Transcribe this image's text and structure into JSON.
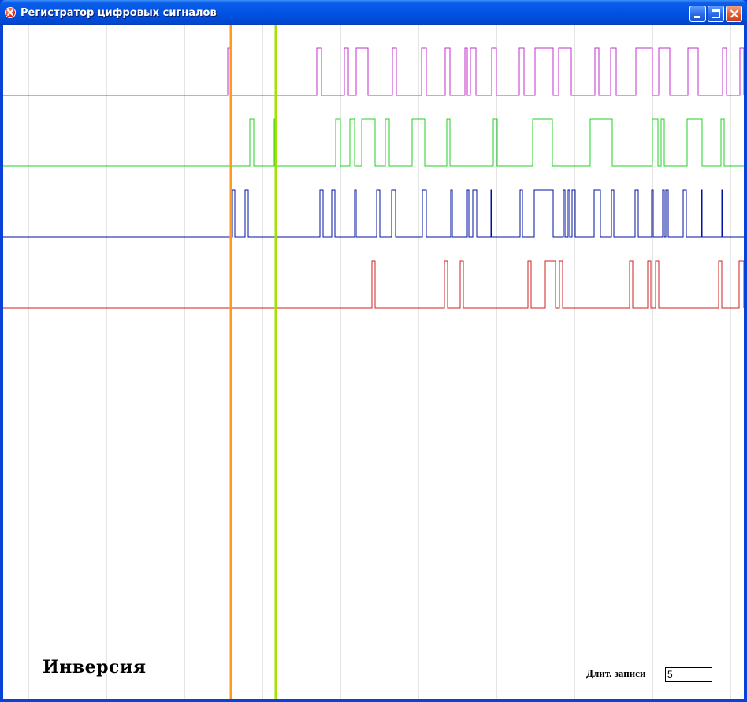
{
  "window": {
    "title": "Регистратор цифровых сигналов"
  },
  "controls": {
    "inversion_label": "Инверсия",
    "duration_label": "Длит. записи",
    "duration_value": "5"
  },
  "colors": {
    "grid": "#c8c8c8",
    "cursor_left": "#ff9a1f",
    "cursor_right": "#a4e000",
    "channels": [
      "#c030c8",
      "#20d020",
      "#0010a0",
      "#d02020"
    ]
  },
  "chart_data": {
    "type": "line",
    "title": "",
    "xlabel": "",
    "ylabel": "",
    "grid": "vertical",
    "cursors": [
      {
        "name": "cursor-left",
        "x": 289
      },
      {
        "name": "cursor-right",
        "x": 346
      }
    ],
    "series": [
      {
        "transitions": [
          285,
          289,
          398,
          404,
          433,
          438,
          448,
          463,
          494,
          499,
          531,
          537,
          561,
          567,
          586,
          589,
          593,
          600,
          620,
          626,
          655,
          661,
          675,
          698,
          705,
          721,
          751,
          756,
          771,
          778,
          803,
          824,
          832,
          846,
          869,
          882,
          913,
          918,
          935,
          940
        ]
      },
      {
        "transitions": [
          313,
          318,
          344,
          346,
          422,
          428,
          440,
          446,
          455,
          472,
          485,
          490,
          519,
          535,
          563,
          567,
          622,
          627,
          672,
          697,
          745,
          773,
          824,
          831,
          835,
          839,
          868,
          887,
          911,
          915
        ]
      },
      {
        "transitions": [
          291,
          294,
          307,
          311,
          345,
          346,
          402,
          406,
          417,
          421,
          446,
          448,
          474,
          478,
          493,
          498,
          532,
          537,
          568,
          570,
          589,
          591,
          596,
          601,
          619,
          620,
          656,
          659,
          674,
          698,
          711,
          713,
          717,
          719,
          722,
          726,
          750,
          758,
          772,
          775,
          802,
          806,
          823,
          825,
          837,
          839,
          841,
          844,
          863,
          867,
          886,
          887,
          912,
          913
        ]
      },
      {
        "transitions": [
          468,
          472,
          560,
          564,
          580,
          584,
          666,
          670,
          688,
          701,
          706,
          710,
          795,
          799,
          818,
          822,
          828,
          832,
          908,
          912,
          934,
          940
        ]
      }
    ]
  }
}
